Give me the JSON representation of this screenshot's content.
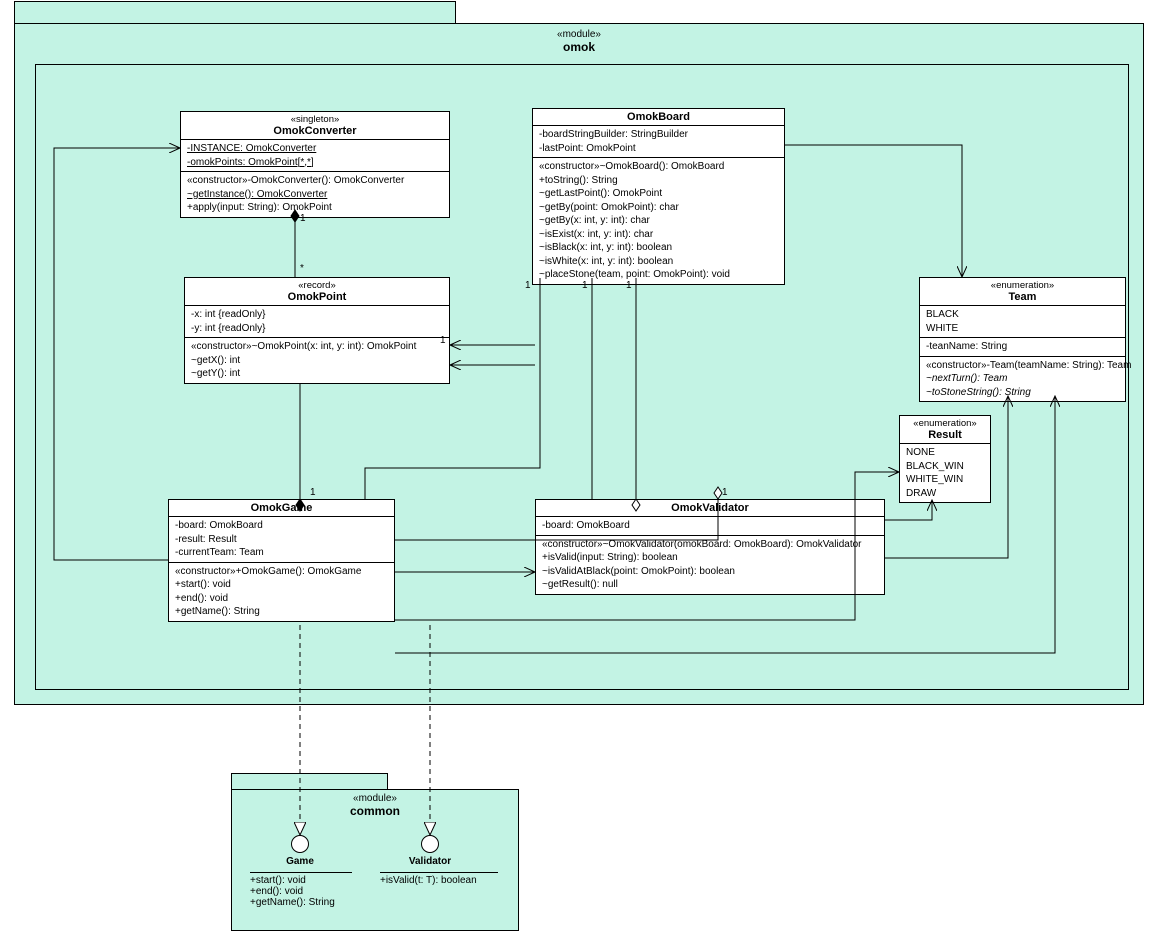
{
  "packages": {
    "omok": {
      "stereo": "«module»",
      "name": "omok"
    },
    "common": {
      "stereo": "«module»",
      "name": "common"
    }
  },
  "classes": {
    "OmokConverter": {
      "stereo": "«singleton»",
      "name": "OmokConverter",
      "attrs": [
        "-INSTANCE: OmokConverter",
        "-omokPoints: OmokPoint[*,*]"
      ],
      "ops": [
        "«constructor»-OmokConverter(): OmokConverter",
        "~getInstance(): OmokConverter",
        "+apply(input: String): OmokPoint"
      ],
      "underlineRows": [
        0,
        1
      ],
      "underlineOps": [
        1
      ]
    },
    "OmokPoint": {
      "stereo": "«record»",
      "name": "OmokPoint",
      "attrs": [
        "-x: int {readOnly}",
        "-y: int {readOnly}"
      ],
      "ops": [
        "«constructor»~OmokPoint(x: int, y: int): OmokPoint",
        "~getX(): int",
        "~getY(): int"
      ]
    },
    "OmokBoard": {
      "stereo": "",
      "name": "OmokBoard",
      "attrs": [
        "-boardStringBuilder: StringBuilder",
        "-lastPoint: OmokPoint"
      ],
      "ops": [
        "«constructor»~OmokBoard(): OmokBoard",
        "+toString(): String",
        "~getLastPoint(): OmokPoint",
        "~getBy(point: OmokPoint): char",
        "~getBy(x: int, y: int): char",
        "~isExist(x: int, y: int): char",
        "~isBlack(x: int, y: int): boolean",
        "~isWhite(x: int, y: int): boolean",
        "~placeStone(team, point: OmokPoint): void"
      ]
    },
    "OmokGame": {
      "stereo": "",
      "name": "OmokGame",
      "attrs": [
        "-board: OmokBoard",
        "-result: Result",
        "-currentTeam: Team"
      ],
      "ops": [
        "«constructor»+OmokGame(): OmokGame",
        "+start(): void",
        "+end(): void",
        "+getName(): String"
      ]
    },
    "OmokValidator": {
      "stereo": "",
      "name": "OmokValidator",
      "attrs": [
        "-board: OmokBoard"
      ],
      "ops": [
        "«constructor»~OmokValidator(omokBoard: OmokBoard): OmokValidator",
        "+isValid(input: String): boolean",
        "~isValidAtBlack(point: OmokPoint): boolean",
        "~getResult(): null"
      ]
    },
    "Team": {
      "stereo": "«enumeration»",
      "name": "Team",
      "literals": [
        "BLACK",
        "WHITE"
      ],
      "attrs": [
        "-teanName: String"
      ],
      "ops": [
        "«constructor»-Team(teamName: String): Team",
        "~nextTurn(): Team",
        "~toStoneString(): String"
      ],
      "italicOps": [
        1,
        2
      ]
    },
    "Result": {
      "stereo": "«enumeration»",
      "name": "Result",
      "literals": [
        "NONE",
        "BLACK_WIN",
        "WHITE_WIN",
        "DRAW"
      ]
    }
  },
  "interfaces": {
    "Game": {
      "name": "Game",
      "ops": [
        "+start(): void",
        "+end(): void",
        "+getName(): String"
      ]
    },
    "Validator": {
      "name": "Validator",
      "ops": [
        "+isValid(t: T): boolean"
      ]
    }
  },
  "multiplicities": {
    "conv_point_top": "1",
    "conv_point_bottom": "*",
    "board_point": "1",
    "board_validator": "1",
    "board_game": "1",
    "game_validator": "1",
    "validator_board": "1"
  }
}
